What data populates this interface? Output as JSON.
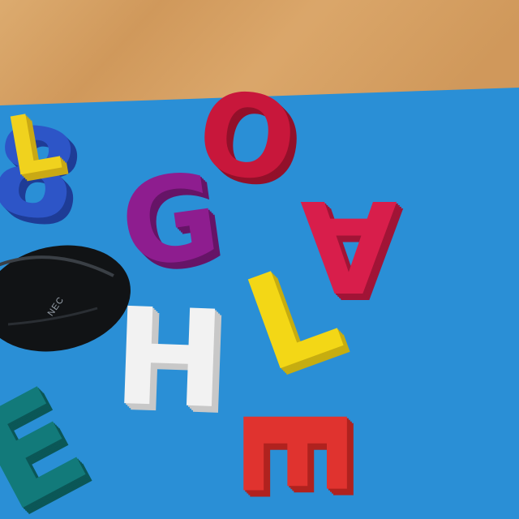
{
  "scene": {
    "description_free": true,
    "table_color": "#d7a264",
    "mat_color": "#2a8fd6",
    "mat_shadow_color": "#1f73b3"
  },
  "letters": [
    {
      "name": "letter-8",
      "char": "8",
      "color": "#2d55c7",
      "side": "#1e3c96"
    },
    {
      "name": "letter-yellow-top",
      "char": "L",
      "color": "#f0d21e",
      "side": "#c9a915"
    },
    {
      "name": "letter-o",
      "char": "O",
      "color": "#c8173b",
      "side": "#93102a"
    },
    {
      "name": "letter-g",
      "char": "G",
      "color": "#8e1d8f",
      "side": "#661467"
    },
    {
      "name": "letter-a",
      "char": "A",
      "color": "#d81e4b",
      "side": "#a11436"
    },
    {
      "name": "letter-l",
      "char": "L",
      "color": "#f3d716",
      "side": "#c6ad10"
    },
    {
      "name": "letter-h",
      "char": "H",
      "color": "#f2f2f2",
      "side": "#c8c8c8"
    },
    {
      "name": "letter-e-teal",
      "char": "E",
      "color": "#127a7a",
      "side": "#0b5757"
    },
    {
      "name": "letter-e-red",
      "char": "E",
      "color": "#e0332f",
      "side": "#b0221f"
    }
  ],
  "mouse": {
    "brand": "NEC",
    "color": "#111315"
  }
}
